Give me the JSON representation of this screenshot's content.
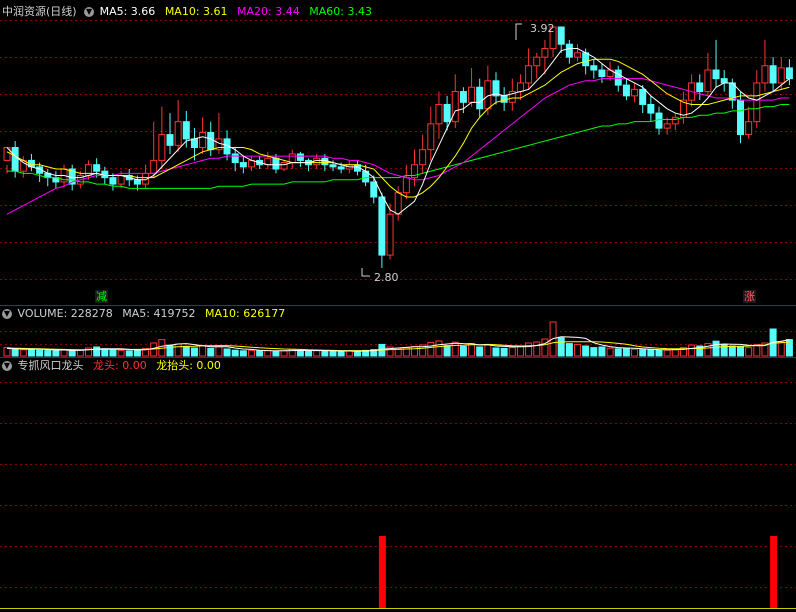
{
  "main_panel": {
    "title": "中润资源(日线)",
    "ma5_label": "MA5: 3.66",
    "ma10_label": "MA10: 3.61",
    "ma20_label": "MA20: 3.44",
    "ma60_label": "MA60: 3.43",
    "high_annotation": "3.92",
    "low_annotation": "2.80",
    "tag_reduce": "减",
    "tag_rise": "涨"
  },
  "volume_panel": {
    "vol_label": "VOLUME: 228278",
    "ma5_label": "MA5: 419752",
    "ma10_label": "MA10: 626177"
  },
  "indicator_panel": {
    "name": "专抓风口龙头",
    "longtou_label": "龙头: 0.00",
    "longtaitou_label": "龙抬头: 0.00"
  },
  "colors": {
    "up": "#ff3232",
    "down": "#54fcfc",
    "ma5": "#ffffff",
    "ma10": "#ffff00",
    "ma20": "#ff00ff",
    "ma60": "#00ff00",
    "grid": "#8b0000"
  },
  "chart_data": {
    "type": "candlestick",
    "price_range": [
      2.8,
      3.92
    ],
    "candles": [
      [
        3.3,
        3.36,
        3.28,
        3.24
      ],
      [
        3.36,
        3.25,
        3.39,
        3.22
      ],
      [
        3.25,
        3.3,
        3.32,
        3.22
      ],
      [
        3.3,
        3.27,
        3.33,
        3.25
      ],
      [
        3.27,
        3.24,
        3.29,
        3.2
      ],
      [
        3.24,
        3.22,
        3.26,
        3.18
      ],
      [
        3.22,
        3.2,
        3.25,
        3.17
      ],
      [
        3.2,
        3.26,
        3.28,
        3.18
      ],
      [
        3.26,
        3.19,
        3.28,
        3.16
      ],
      [
        3.19,
        3.23,
        3.25,
        3.17
      ],
      [
        3.23,
        3.28,
        3.3,
        3.21
      ],
      [
        3.28,
        3.25,
        3.31,
        3.22
      ],
      [
        3.25,
        3.22,
        3.27,
        3.19
      ],
      [
        3.22,
        3.19,
        3.24,
        3.16
      ],
      [
        3.19,
        3.23,
        3.25,
        3.17
      ],
      [
        3.23,
        3.21,
        3.26,
        3.18
      ],
      [
        3.21,
        3.19,
        3.23,
        3.16
      ],
      [
        3.19,
        3.24,
        3.28,
        3.17
      ],
      [
        3.24,
        3.3,
        3.48,
        3.22
      ],
      [
        3.3,
        3.42,
        3.55,
        3.26
      ],
      [
        3.42,
        3.37,
        3.52,
        3.33
      ],
      [
        3.37,
        3.48,
        3.58,
        3.34
      ],
      [
        3.48,
        3.4,
        3.53,
        3.36
      ],
      [
        3.4,
        3.36,
        3.45,
        3.3
      ],
      [
        3.36,
        3.43,
        3.5,
        3.33
      ],
      [
        3.43,
        3.35,
        3.48,
        3.32
      ],
      [
        3.35,
        3.4,
        3.52,
        3.33
      ],
      [
        3.4,
        3.33,
        3.44,
        3.3
      ],
      [
        3.33,
        3.29,
        3.36,
        3.25
      ],
      [
        3.29,
        3.27,
        3.32,
        3.24
      ],
      [
        3.27,
        3.3,
        3.32,
        3.25
      ],
      [
        3.3,
        3.28,
        3.32,
        3.26
      ],
      [
        3.28,
        3.31,
        3.34,
        3.26
      ],
      [
        3.31,
        3.26,
        3.33,
        3.24
      ],
      [
        3.26,
        3.29,
        3.3,
        3.25
      ],
      [
        3.29,
        3.33,
        3.35,
        3.26
      ],
      [
        3.33,
        3.3,
        3.34,
        3.27
      ],
      [
        3.3,
        3.28,
        3.31,
        3.25
      ],
      [
        3.28,
        3.31,
        3.33,
        3.26
      ],
      [
        3.31,
        3.28,
        3.33,
        3.25
      ],
      [
        3.28,
        3.27,
        3.3,
        3.25
      ],
      [
        3.27,
        3.26,
        3.29,
        3.24
      ],
      [
        3.26,
        3.28,
        3.3,
        3.24
      ],
      [
        3.28,
        3.25,
        3.3,
        3.23
      ],
      [
        3.25,
        3.2,
        3.28,
        3.18
      ],
      [
        3.2,
        3.13,
        3.23,
        3.1
      ],
      [
        3.13,
        2.86,
        3.15,
        2.8
      ],
      [
        2.86,
        3.05,
        3.1,
        2.84
      ],
      [
        3.05,
        3.15,
        3.18,
        3.02
      ],
      [
        3.15,
        3.22,
        3.28,
        3.12
      ],
      [
        3.22,
        3.28,
        3.35,
        3.18
      ],
      [
        3.28,
        3.35,
        3.42,
        3.24
      ],
      [
        3.35,
        3.47,
        3.55,
        3.3
      ],
      [
        3.47,
        3.56,
        3.62,
        3.4
      ],
      [
        3.56,
        3.48,
        3.6,
        3.44
      ],
      [
        3.48,
        3.62,
        3.7,
        3.45
      ],
      [
        3.62,
        3.57,
        3.64,
        3.52
      ],
      [
        3.57,
        3.64,
        3.73,
        3.55
      ],
      [
        3.64,
        3.54,
        3.68,
        3.5
      ],
      [
        3.54,
        3.67,
        3.74,
        3.51
      ],
      [
        3.67,
        3.6,
        3.71,
        3.56
      ],
      [
        3.6,
        3.57,
        3.64,
        3.53
      ],
      [
        3.57,
        3.62,
        3.68,
        3.53
      ],
      [
        3.62,
        3.66,
        3.7,
        3.58
      ],
      [
        3.66,
        3.74,
        3.82,
        3.63
      ],
      [
        3.74,
        3.78,
        3.8,
        3.68
      ],
      [
        3.78,
        3.82,
        3.86,
        3.7
      ],
      [
        3.82,
        3.92,
        3.92,
        3.78
      ],
      [
        3.92,
        3.84,
        3.92,
        3.8
      ],
      [
        3.84,
        3.78,
        3.86,
        3.75
      ],
      [
        3.78,
        3.8,
        3.84,
        3.76
      ],
      [
        3.8,
        3.74,
        3.82,
        3.7
      ],
      [
        3.74,
        3.72,
        3.77,
        3.68
      ],
      [
        3.72,
        3.69,
        3.75,
        3.66
      ],
      [
        3.69,
        3.72,
        3.76,
        3.67
      ],
      [
        3.72,
        3.65,
        3.74,
        3.62
      ],
      [
        3.65,
        3.6,
        3.68,
        3.58
      ],
      [
        3.6,
        3.63,
        3.66,
        3.57
      ],
      [
        3.63,
        3.56,
        3.65,
        3.52
      ],
      [
        3.56,
        3.52,
        3.6,
        3.48
      ],
      [
        3.52,
        3.45,
        3.55,
        3.42
      ],
      [
        3.45,
        3.47,
        3.5,
        3.42
      ],
      [
        3.47,
        3.5,
        3.52,
        3.44
      ],
      [
        3.5,
        3.58,
        3.62,
        3.47
      ],
      [
        3.58,
        3.66,
        3.7,
        3.55
      ],
      [
        3.66,
        3.62,
        3.7,
        3.58
      ],
      [
        3.62,
        3.72,
        3.8,
        3.6
      ],
      [
        3.72,
        3.68,
        3.86,
        3.64
      ],
      [
        3.68,
        3.66,
        3.72,
        3.62
      ],
      [
        3.66,
        3.58,
        3.68,
        3.54
      ],
      [
        3.58,
        3.42,
        3.62,
        3.38
      ],
      [
        3.42,
        3.48,
        3.55,
        3.4
      ],
      [
        3.48,
        3.66,
        3.72,
        3.45
      ],
      [
        3.66,
        3.74,
        3.86,
        3.62
      ],
      [
        3.74,
        3.66,
        3.78,
        3.62
      ],
      [
        3.66,
        3.73,
        3.78,
        3.63
      ],
      [
        3.73,
        3.68,
        3.77,
        3.65
      ]
    ],
    "ma5": [
      3.36,
      3.32,
      3.29,
      3.27,
      3.26,
      3.24,
      3.23,
      3.23,
      3.22,
      3.22,
      3.23,
      3.24,
      3.23,
      3.23,
      3.23,
      3.22,
      3.21,
      3.21,
      3.23,
      3.27,
      3.31,
      3.35,
      3.39,
      3.4,
      3.41,
      3.4,
      3.38,
      3.37,
      3.35,
      3.32,
      3.3,
      3.29,
      3.28,
      3.28,
      3.28,
      3.29,
      3.29,
      3.29,
      3.3,
      3.3,
      3.29,
      3.28,
      3.27,
      3.27,
      3.25,
      3.22,
      3.14,
      3.07,
      3.05,
      3.08,
      3.11,
      3.19,
      3.29,
      3.37,
      3.45,
      3.53,
      3.54,
      3.57,
      3.57,
      3.6,
      3.61,
      3.6,
      3.61,
      3.62,
      3.63,
      3.67,
      3.71,
      3.76,
      3.81,
      3.82,
      3.82,
      3.8,
      3.78,
      3.75,
      3.72,
      3.7,
      3.68,
      3.66,
      3.64,
      3.6,
      3.57,
      3.54,
      3.52,
      3.51,
      3.52,
      3.55,
      3.59,
      3.64,
      3.66,
      3.66,
      3.62,
      3.59,
      3.58,
      3.6,
      3.62,
      3.65,
      3.68
    ],
    "ma10": [
      3.34,
      3.32,
      3.3,
      3.28,
      3.28,
      3.27,
      3.26,
      3.26,
      3.25,
      3.24,
      3.24,
      3.24,
      3.23,
      3.23,
      3.23,
      3.23,
      3.22,
      3.22,
      3.22,
      3.24,
      3.26,
      3.28,
      3.3,
      3.32,
      3.34,
      3.35,
      3.36,
      3.36,
      3.36,
      3.36,
      3.35,
      3.33,
      3.32,
      3.31,
      3.3,
      3.29,
      3.29,
      3.29,
      3.29,
      3.29,
      3.29,
      3.28,
      3.28,
      3.28,
      3.27,
      3.26,
      3.22,
      3.18,
      3.15,
      3.13,
      3.13,
      3.15,
      3.18,
      3.22,
      3.27,
      3.32,
      3.38,
      3.45,
      3.5,
      3.54,
      3.57,
      3.58,
      3.59,
      3.59,
      3.61,
      3.63,
      3.65,
      3.68,
      3.71,
      3.73,
      3.75,
      3.76,
      3.77,
      3.77,
      3.77,
      3.76,
      3.74,
      3.72,
      3.7,
      3.67,
      3.64,
      3.61,
      3.59,
      3.57,
      3.56,
      3.56,
      3.56,
      3.57,
      3.58,
      3.59,
      3.6,
      3.6,
      3.6,
      3.61,
      3.62,
      3.63,
      3.64
    ],
    "ma20": [
      3.05,
      3.07,
      3.09,
      3.11,
      3.13,
      3.15,
      3.17,
      3.18,
      3.2,
      3.21,
      3.22,
      3.23,
      3.23,
      3.23,
      3.24,
      3.24,
      3.24,
      3.24,
      3.24,
      3.25,
      3.26,
      3.27,
      3.28,
      3.29,
      3.3,
      3.31,
      3.31,
      3.32,
      3.32,
      3.32,
      3.32,
      3.32,
      3.32,
      3.32,
      3.32,
      3.32,
      3.32,
      3.32,
      3.32,
      3.32,
      3.31,
      3.31,
      3.3,
      3.3,
      3.29,
      3.28,
      3.26,
      3.24,
      3.23,
      3.22,
      3.21,
      3.21,
      3.22,
      3.23,
      3.25,
      3.27,
      3.29,
      3.32,
      3.35,
      3.38,
      3.41,
      3.44,
      3.47,
      3.5,
      3.53,
      3.56,
      3.59,
      3.61,
      3.63,
      3.65,
      3.66,
      3.67,
      3.67,
      3.68,
      3.68,
      3.68,
      3.68,
      3.68,
      3.68,
      3.67,
      3.66,
      3.65,
      3.64,
      3.63,
      3.62,
      3.61,
      3.6,
      3.59,
      3.59,
      3.59,
      3.58,
      3.58,
      3.58,
      3.58,
      3.58,
      3.59,
      3.59
    ],
    "ma60": [
      3.25,
      3.25,
      3.24,
      3.24,
      3.23,
      3.22,
      3.22,
      3.21,
      3.21,
      3.2,
      3.2,
      3.19,
      3.19,
      3.18,
      3.18,
      3.17,
      3.17,
      3.17,
      3.17,
      3.17,
      3.17,
      3.17,
      3.17,
      3.17,
      3.17,
      3.17,
      3.18,
      3.18,
      3.18,
      3.18,
      3.19,
      3.19,
      3.19,
      3.19,
      3.19,
      3.2,
      3.2,
      3.2,
      3.2,
      3.2,
      3.21,
      3.21,
      3.21,
      3.21,
      3.22,
      3.22,
      3.22,
      3.22,
      3.22,
      3.23,
      3.23,
      3.24,
      3.25,
      3.26,
      3.27,
      3.28,
      3.29,
      3.3,
      3.31,
      3.32,
      3.33,
      3.34,
      3.35,
      3.36,
      3.37,
      3.38,
      3.39,
      3.4,
      3.41,
      3.42,
      3.43,
      3.44,
      3.45,
      3.46,
      3.46,
      3.47,
      3.47,
      3.48,
      3.48,
      3.48,
      3.49,
      3.49,
      3.49,
      3.5,
      3.5,
      3.51,
      3.51,
      3.52,
      3.52,
      3.53,
      3.53,
      3.54,
      3.54,
      3.55,
      3.55,
      3.56,
      3.56
    ],
    "volume": [
      4.2,
      3.8,
      3.1,
      3.4,
      2.9,
      2.7,
      2.5,
      3.2,
      2.8,
      3.0,
      4.0,
      4.5,
      3.6,
      3.0,
      2.8,
      2.6,
      3.2,
      3.8,
      6.5,
      8.2,
      5.4,
      6.0,
      4.8,
      4.0,
      5.2,
      3.8,
      4.6,
      3.5,
      2.9,
      2.6,
      2.8,
      2.5,
      2.7,
      2.4,
      2.6,
      3.4,
      2.8,
      2.5,
      2.6,
      2.4,
      2.5,
      2.3,
      2.6,
      2.4,
      2.8,
      3.2,
      5.8,
      4.5,
      3.9,
      4.2,
      4.8,
      5.5,
      6.8,
      7.5,
      5.2,
      6.9,
      4.8,
      6.2,
      4.5,
      5.6,
      4.0,
      3.8,
      4.2,
      4.8,
      6.5,
      7.0,
      8.5,
      17.0,
      9.0,
      6.2,
      5.8,
      5.0,
      4.2,
      4.5,
      3.9,
      3.6,
      4.0,
      3.4,
      3.2,
      3.0,
      2.8,
      2.9,
      3.4,
      4.2,
      5.5,
      5.0,
      6.2,
      7.4,
      5.8,
      5.0,
      4.6,
      4.2,
      5.8,
      6.5,
      13.5,
      7.0,
      8.2
    ],
    "volume_ma5": [
      3.8,
      3.6,
      3.5,
      3.4,
      3.5,
      3.2,
      3.0,
      3.0,
      2.8,
      2.8,
      3.1,
      3.5,
      3.6,
      3.6,
      3.6,
      3.3,
      3.0,
      3.1,
      3.8,
      4.9,
      5.4,
      6.0,
      6.2,
      5.7,
      5.1,
      4.6,
      4.6,
      4.6,
      4.0,
      3.5,
      3.3,
      2.9,
      2.7,
      2.6,
      2.6,
      2.7,
      2.8,
      2.7,
      2.8,
      2.7,
      2.6,
      2.5,
      2.5,
      2.4,
      2.5,
      2.7,
      3.4,
      3.7,
      4.0,
      4.3,
      4.6,
      4.6,
      5.0,
      5.6,
      6.0,
      6.4,
      6.2,
      6.1,
      5.5,
      5.6,
      5.0,
      4.8,
      4.6,
      4.6,
      4.7,
      5.3,
      6.2,
      8.7,
      9.6,
      9.5,
      9.3,
      8.8,
      6.6,
      5.5,
      4.7,
      4.2,
      4.0,
      3.9,
      3.6,
      3.4,
      3.2,
      3.1,
      3.1,
      3.3,
      3.8,
      4.2,
      4.9,
      5.7,
      6.0,
      5.9,
      5.8,
      5.4,
      5.1,
      5.2,
      6.9,
      7.4,
      8.2
    ],
    "volume_ma10": [
      4.0,
      3.9,
      3.8,
      3.7,
      3.6,
      3.5,
      3.4,
      3.3,
      3.2,
      3.1,
      3.2,
      3.2,
      3.3,
      3.3,
      3.3,
      3.3,
      3.3,
      3.3,
      3.5,
      3.9,
      4.3,
      4.6,
      4.8,
      4.9,
      5.1,
      5.1,
      5.2,
      5.2,
      5.0,
      4.7,
      4.4,
      4.1,
      3.9,
      3.7,
      3.5,
      3.4,
      3.3,
      3.1,
      3.0,
      2.9,
      2.8,
      2.7,
      2.7,
      2.7,
      2.7,
      2.7,
      3.0,
      3.2,
      3.3,
      3.5,
      3.6,
      3.9,
      4.3,
      4.7,
      5.0,
      5.3,
      5.4,
      5.6,
      5.6,
      5.8,
      5.6,
      5.4,
      5.1,
      5.0,
      5.1,
      5.2,
      5.6,
      6.6,
      7.0,
      7.1,
      7.1,
      7.1,
      7.1,
      7.0,
      6.7,
      6.3,
      5.9,
      5.1,
      4.5,
      4.2,
      3.9,
      3.7,
      3.6,
      3.6,
      3.7,
      3.8,
      4.0,
      4.4,
      4.7,
      4.8,
      4.9,
      5.0,
      5.3,
      5.5,
      6.4,
      6.6,
      7.0
    ],
    "signal": [
      0,
      0,
      0,
      0,
      0,
      0,
      0,
      0,
      0,
      0,
      0,
      0,
      0,
      0,
      0,
      0,
      0,
      0,
      0,
      0,
      0,
      0,
      0,
      0,
      0,
      0,
      0,
      0,
      0,
      0,
      0,
      0,
      0,
      0,
      0,
      0,
      0,
      0,
      0,
      0,
      0,
      0,
      0,
      0,
      0,
      0,
      1,
      0,
      0,
      0,
      0,
      0,
      0,
      0,
      0,
      0,
      0,
      0,
      0,
      0,
      0,
      0,
      0,
      0,
      0,
      0,
      0,
      0,
      0,
      0,
      0,
      0,
      0,
      0,
      0,
      0,
      0,
      0,
      0,
      0,
      0,
      0,
      0,
      0,
      0,
      0,
      0,
      0,
      0,
      0,
      0,
      0,
      0,
      0,
      1,
      0,
      0
    ]
  }
}
